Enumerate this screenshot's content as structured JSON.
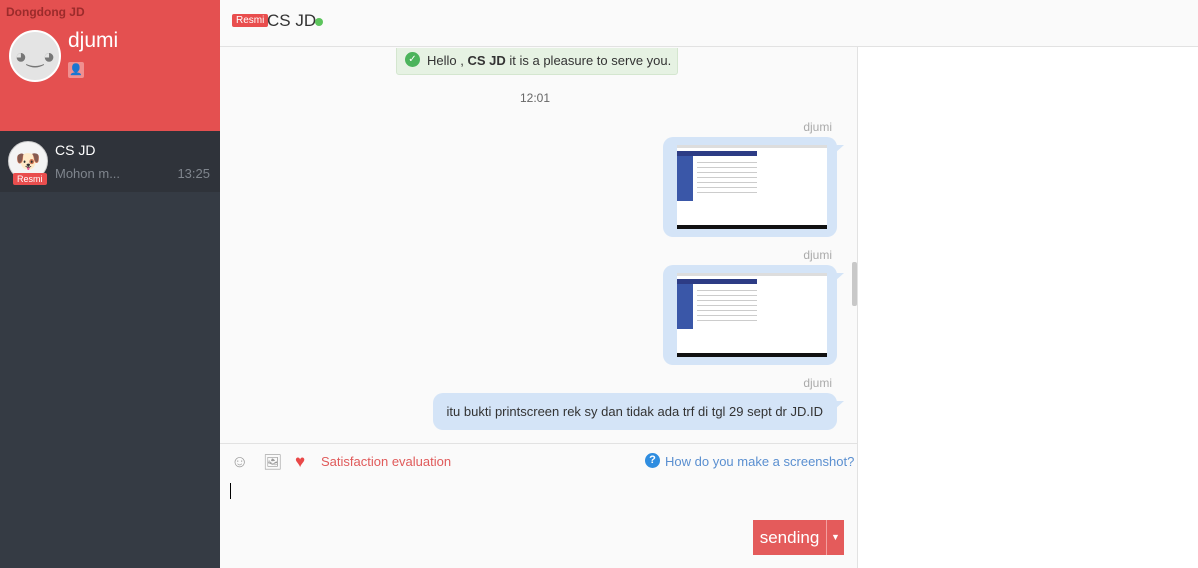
{
  "app_title": "Dongdong JD",
  "user": {
    "name": "djumi"
  },
  "conversations": [
    {
      "name": "CS JD",
      "badge": "Resmi",
      "preview": "Mohon m...",
      "time": "13:25"
    }
  ],
  "header": {
    "badge": "Resmi",
    "name": "CS JD",
    "status_color": "#5cc45c"
  },
  "chat": {
    "welcome": {
      "prefix": "Hello , ",
      "bold": "CS JD",
      "suffix": " it is a pleasure to serve you."
    },
    "time_separator": "12:01",
    "messages": [
      {
        "sender": "djumi",
        "type": "image"
      },
      {
        "sender": "djumi",
        "type": "image"
      },
      {
        "sender": "djumi",
        "type": "text",
        "text": "itu bukti printscreen rek sy dan tidak ada trf di tgl 29 sept dr JD.ID"
      }
    ]
  },
  "composer": {
    "satisfaction_label": "Satisfaction evaluation",
    "help_label": "How do you make a screenshot?",
    "send_label": "sending",
    "value": ""
  },
  "colors": {
    "brand": "#e45050",
    "sidebar": "#353b44",
    "bubble": "#d4e4f7"
  }
}
